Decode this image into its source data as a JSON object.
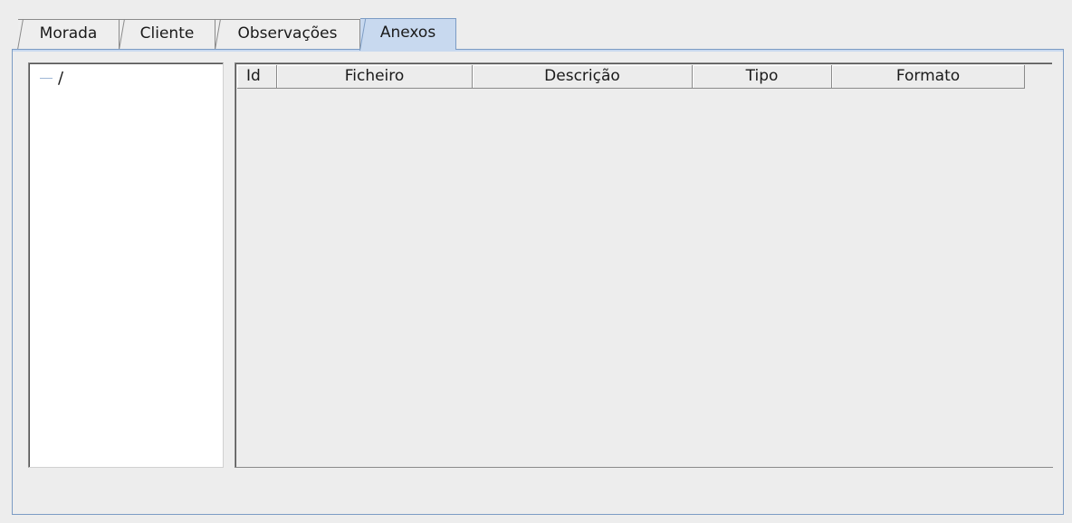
{
  "tabs": [
    {
      "label": "Morada"
    },
    {
      "label": "Cliente"
    },
    {
      "label": "Observações"
    },
    {
      "label": "Anexos",
      "active": true
    }
  ],
  "tree": {
    "root_label": "/"
  },
  "table": {
    "columns": [
      "Id",
      "Ficheiro",
      "Descrição",
      "Tipo",
      "Formato"
    ],
    "rows": []
  },
  "colors": {
    "active_tab": "#c8d9ef",
    "panel_border": "#7c9cc4",
    "background": "#ededed"
  }
}
